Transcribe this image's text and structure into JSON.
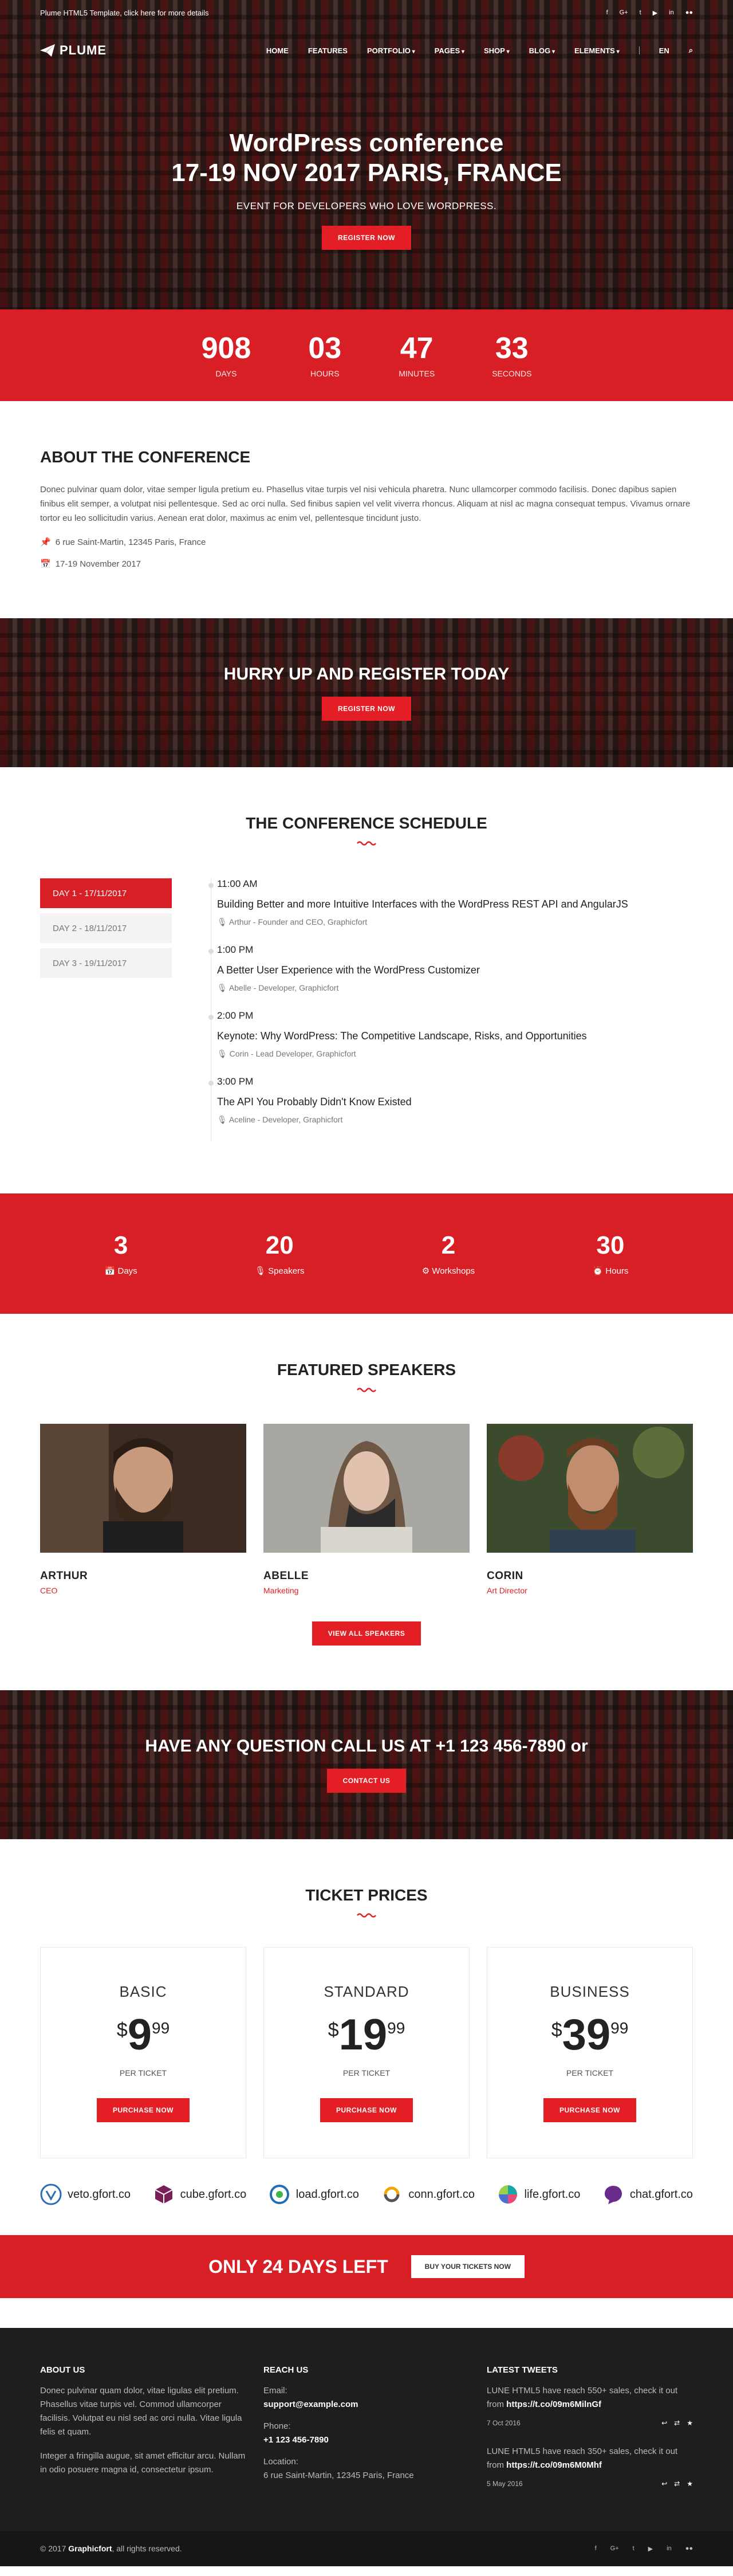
{
  "topbar": {
    "notice": "Plume HTML5 Template, click here for more details",
    "social_icons": [
      "facebook-icon",
      "google-plus-icon",
      "twitter-icon",
      "youtube-icon",
      "linkedin-icon",
      "flickr-icon"
    ],
    "social_glyphs": [
      "f",
      "G+",
      "t",
      "▶",
      "in",
      "●●"
    ]
  },
  "nav": {
    "brand": "PLUME",
    "items": [
      {
        "label": "HOME",
        "dd": false
      },
      {
        "label": "FEATURES",
        "dd": false
      },
      {
        "label": "PORTFOLIO",
        "dd": true
      },
      {
        "label": "PAGES",
        "dd": true
      },
      {
        "label": "SHOP",
        "dd": true
      },
      {
        "label": "BLOG",
        "dd": true
      },
      {
        "label": "ELEMENTS",
        "dd": true
      }
    ],
    "lang": "EN",
    "search_glyph": "⌕"
  },
  "hero": {
    "title_line1": "WordPress conference",
    "title_line2": "17-19 NOV 2017 PARIS, FRANCE",
    "subtitle": "EVENT FOR DEVELOPERS WHO LOVE WORDPRESS.",
    "button": "REGISTER NOW"
  },
  "countdown": [
    {
      "value": "908",
      "label": "DAYS"
    },
    {
      "value": "03",
      "label": "HOURS"
    },
    {
      "value": "47",
      "label": "MINUTES"
    },
    {
      "value": "33",
      "label": "SECONDS"
    }
  ],
  "about": {
    "heading": "ABOUT THE CONFERENCE",
    "text": "Donec pulvinar quam dolor, vitae semper ligula pretium eu. Phasellus vitae turpis vel nisi vehicula pharetra. Nunc ullamcorper commodo facilisis. Donec dapibus sapien finibus elit semper, a volutpat nisi pellentesque. Sed ac orci nulla. Sed finibus sapien vel velit viverra rhoncus. Aliquam at nisl ac magna consequat tempus. Vivamus ornare tortor eu leo sollicitudin varius. Aenean erat dolor, maximus ac enim vel, pellentesque tincidunt justo.",
    "address": "6 rue Saint-Martin, 12345 Paris, France",
    "date": "17-19 November 2017"
  },
  "register_cta": {
    "heading": "HURRY UP AND REGISTER TODAY",
    "button": "REGISTER NOW"
  },
  "schedule": {
    "heading": "THE CONFERENCE SCHEDULE",
    "days": [
      "DAY 1 - 17/11/2017",
      "DAY 2 - 18/11/2017",
      "DAY 3 - 19/11/2017"
    ],
    "events": [
      {
        "time": "11:00 AM",
        "title": "Building Better and more Intuitive Interfaces with the WordPress REST API and AngularJS",
        "speaker": "Arthur - Founder and CEO, Graphicfort"
      },
      {
        "time": "1:00 PM",
        "title": "A Better User Experience with the WordPress Customizer",
        "speaker": "Abelle - Developer, Graphicfort"
      },
      {
        "time": "2:00 PM",
        "title": "Keynote: Why WordPress: The Competitive Landscape, Risks, and Opportunities",
        "speaker": "Corin - Lead Developer, Graphicfort"
      },
      {
        "time": "3:00 PM",
        "title": "The API You Probably Didn't Know Existed",
        "speaker": "Aceline - Developer, Graphicfort"
      }
    ]
  },
  "stats": [
    {
      "value": "3",
      "label": "Days",
      "icon": "calendar-icon"
    },
    {
      "value": "20",
      "label": "Speakers",
      "icon": "microphone-icon"
    },
    {
      "value": "2",
      "label": "Workshops",
      "icon": "gear-icon"
    },
    {
      "value": "30",
      "label": "Hours",
      "icon": "clock-icon"
    }
  ],
  "speakers": {
    "heading": "FEATURED SPEAKERS",
    "list": [
      {
        "name": "ARTHUR",
        "role": "CEO"
      },
      {
        "name": "ABELLE",
        "role": "Marketing"
      },
      {
        "name": "CORIN",
        "role": "Art Director"
      }
    ],
    "button": "VIEW ALL SPEAKERS"
  },
  "contact_cta": {
    "heading": "HAVE ANY QUESTION CALL US AT +1 123 456-7890 or",
    "button": "CONTACT US"
  },
  "pricing": {
    "heading": "TICKET PRICES",
    "tiers": [
      {
        "name": "BASIC",
        "currency": "$",
        "amount": "9",
        "cents": "99",
        "per": "PER TICKET",
        "button": "PURCHASE NOW"
      },
      {
        "name": "STANDARD",
        "currency": "$",
        "amount": "19",
        "cents": "99",
        "per": "PER TICKET",
        "button": "PURCHASE NOW"
      },
      {
        "name": "BUSINESS",
        "currency": "$",
        "amount": "39",
        "cents": "99",
        "per": "PER TICKET",
        "button": "PURCHASE NOW"
      }
    ]
  },
  "clients": [
    {
      "label": "veto.gfort.co",
      "color": "#2a6db5"
    },
    {
      "label": "cube.gfort.co",
      "color": "#7a1e5a"
    },
    {
      "label": "load.gfort.co",
      "color": "#1f6fb2"
    },
    {
      "label": "conn.gfort.co",
      "color": "#f0a500"
    },
    {
      "label": "life.gfort.co",
      "color": "#18a6a6"
    },
    {
      "label": "chat.gfort.co",
      "color": "#6a2c8a"
    }
  ],
  "banner": {
    "heading": "ONLY 24 DAYS LEFT",
    "button": "BUY YOUR TICKETS NOW"
  },
  "footer": {
    "about_h": "ABOUT US",
    "about_p1": "Donec pulvinar quam dolor, vitae ligulas elit pretium. Phasellus vitae turpis vel. Commod ullamcorper facilisis. Volutpat eu nisl sed ac orci nulla. Vitae ligula felis et quam.",
    "about_p2": "Integer a fringilla augue, sit amet efficitur arcu. Nullam in odio posuere magna id, consectetur ipsum.",
    "reach_h": "REACH US",
    "email_l": "Email:",
    "email": "support@example.com",
    "phone_l": "Phone:",
    "phone": "+1 123 456-7890",
    "loc_l": "Location:",
    "loc": "6 rue Saint-Martin, 12345 Paris, France",
    "tweets_h": "LATEST TWEETS",
    "tweets": [
      {
        "text": "LUNE HTML5 have reach 550+ sales, check it out from",
        "link": "https://t.co/09m6MilnGf",
        "date": "7 Oct 2016"
      },
      {
        "text": "LUNE HTML5 have reach 350+ sales, check it out from",
        "link": "https://t.co/09m6M0Mhf",
        "date": "5 May 2016"
      }
    ]
  },
  "copyright": {
    "text": "© 2017 ",
    "brand": "Graphicfort",
    "rest": ", all rights reserved."
  },
  "theme": {
    "accent": "#e31e24",
    "dark": "#1e1e1e"
  }
}
